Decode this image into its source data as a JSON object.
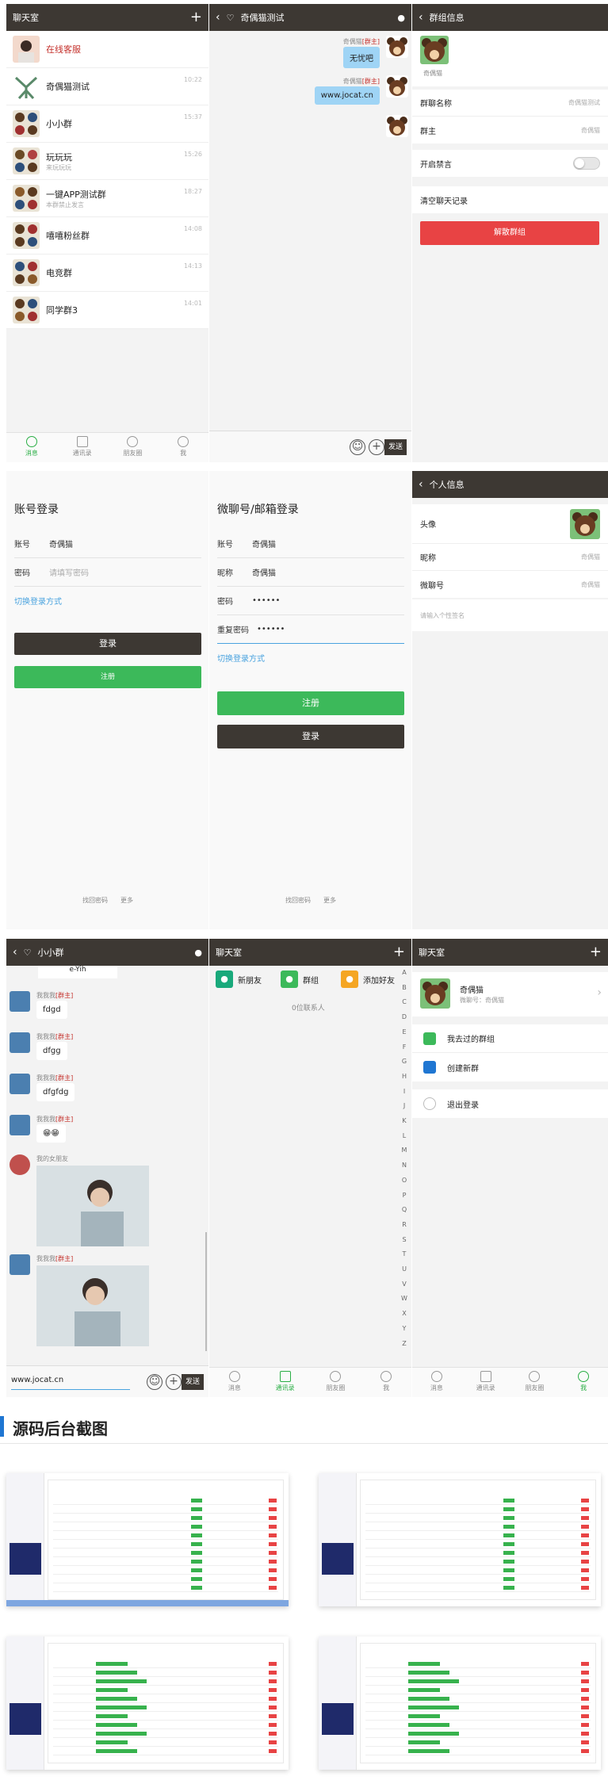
{
  "chat_list": {
    "title": "聊天室",
    "items": [
      {
        "name": "在线客服",
        "time": "",
        "sub": "",
        "red": true
      },
      {
        "name": "奇偶猫测试",
        "time": "10:22",
        "sub": ""
      },
      {
        "name": "小小群",
        "time": "15:37",
        "sub": ""
      },
      {
        "name": "玩玩玩",
        "time": "15:26",
        "sub": "来玩玩玩"
      },
      {
        "name": "一键APP测试群",
        "time": "18:27",
        "sub": "本群禁止发言"
      },
      {
        "name": "嘻嘻粉丝群",
        "time": "14:08",
        "sub": ""
      },
      {
        "name": "电竞群",
        "time": "14:13",
        "sub": ""
      },
      {
        "name": "同学群3",
        "time": "14:01",
        "sub": ""
      }
    ],
    "tabs": [
      "消息",
      "通讯录",
      "朋友圈",
      "我"
    ]
  },
  "group_chat": {
    "title": "奇偶猫测试",
    "sender1": "奇偶猫",
    "role1": "[群主]",
    "msg1": "无忧吧",
    "sender2": "奇偶猫",
    "role2": "[群主]",
    "msg2": "www.jocat.cn",
    "send": "发送"
  },
  "group_info": {
    "title": "群组信息",
    "member_name": "奇偶猫",
    "name_label": "群聊名称",
    "name_value": "奇偶猫测试",
    "owner_label": "群主",
    "owner_value": "奇偶猫",
    "mute_label": "开启禁言",
    "clear_label": "清空聊天记录",
    "dismiss": "解散群组"
  },
  "login": {
    "title": "账号登录",
    "account_label": "账号",
    "account_value": "奇偶猫",
    "pwd_label": "密码",
    "pwd_placeholder": "请填写密码",
    "switch": "切换登录方式",
    "login_btn": "登录",
    "register_btn": "注册",
    "foot1": "找回密码",
    "foot2": "更多"
  },
  "register": {
    "title": "微聊号/邮箱登录",
    "account_label": "账号",
    "account_value": "奇偶猫",
    "nick_label": "昵称",
    "nick_value": "奇偶猫",
    "pwd_label": "密码",
    "pwd_value": "••••••",
    "repwd_label": "重复密码",
    "repwd_value": "••••••",
    "switch": "切换登录方式",
    "register_btn": "注册",
    "login_btn": "登录",
    "foot1": "找回密码",
    "foot2": "更多"
  },
  "profile": {
    "title": "个人信息",
    "avatar_label": "头像",
    "nick_label": "昵称",
    "nick_value": "奇偶猫",
    "id_label": "微聊号",
    "id_value": "奇偶猫",
    "sign_placeholder": "请输入个性签名"
  },
  "small_group": {
    "title": "小小群",
    "top_label": "e-Yih",
    "msgs": [
      {
        "sender": "我我我",
        "role": "[群主]",
        "text": "fdgd"
      },
      {
        "sender": "我我我",
        "role": "[群主]",
        "text": "dfgg"
      },
      {
        "sender": "我我我",
        "role": "[群主]",
        "text": "dfgfdg"
      },
      {
        "sender": "我我我",
        "role": "[群主]",
        "text": "😁😁"
      }
    ],
    "other_sender": "我的女朋友",
    "last_sender": "我我我",
    "last_role": "[群主]",
    "input_value": "www.jocat.cn",
    "send": "发送"
  },
  "contacts": {
    "title": "聊天室",
    "new_friend": "新朋友",
    "groups": "群组",
    "add_friend": "添加好友",
    "count": "0位联系人",
    "letters": [
      "A",
      "B",
      "C",
      "D",
      "E",
      "F",
      "G",
      "H",
      "I",
      "J",
      "K",
      "L",
      "M",
      "N",
      "O",
      "P",
      "Q",
      "R",
      "S",
      "T",
      "U",
      "V",
      "W",
      "X",
      "Y",
      "Z"
    ],
    "tabs": [
      "消息",
      "通讯录",
      "朋友圈",
      "我"
    ]
  },
  "me": {
    "title": "聊天室",
    "name": "奇偶猫",
    "id": "微聊号：奇偶猫",
    "joined": "我去过的群组",
    "create": "创建新群",
    "logout": "退出登录",
    "tabs": [
      "消息",
      "通讯录",
      "朋友圈",
      "我"
    ]
  },
  "section": {
    "title": "源码后台截图"
  },
  "colors": {
    "header": "#3d3833",
    "green": "#3cb95a",
    "red": "#e84344",
    "blue_accent": "#1f76d2"
  }
}
